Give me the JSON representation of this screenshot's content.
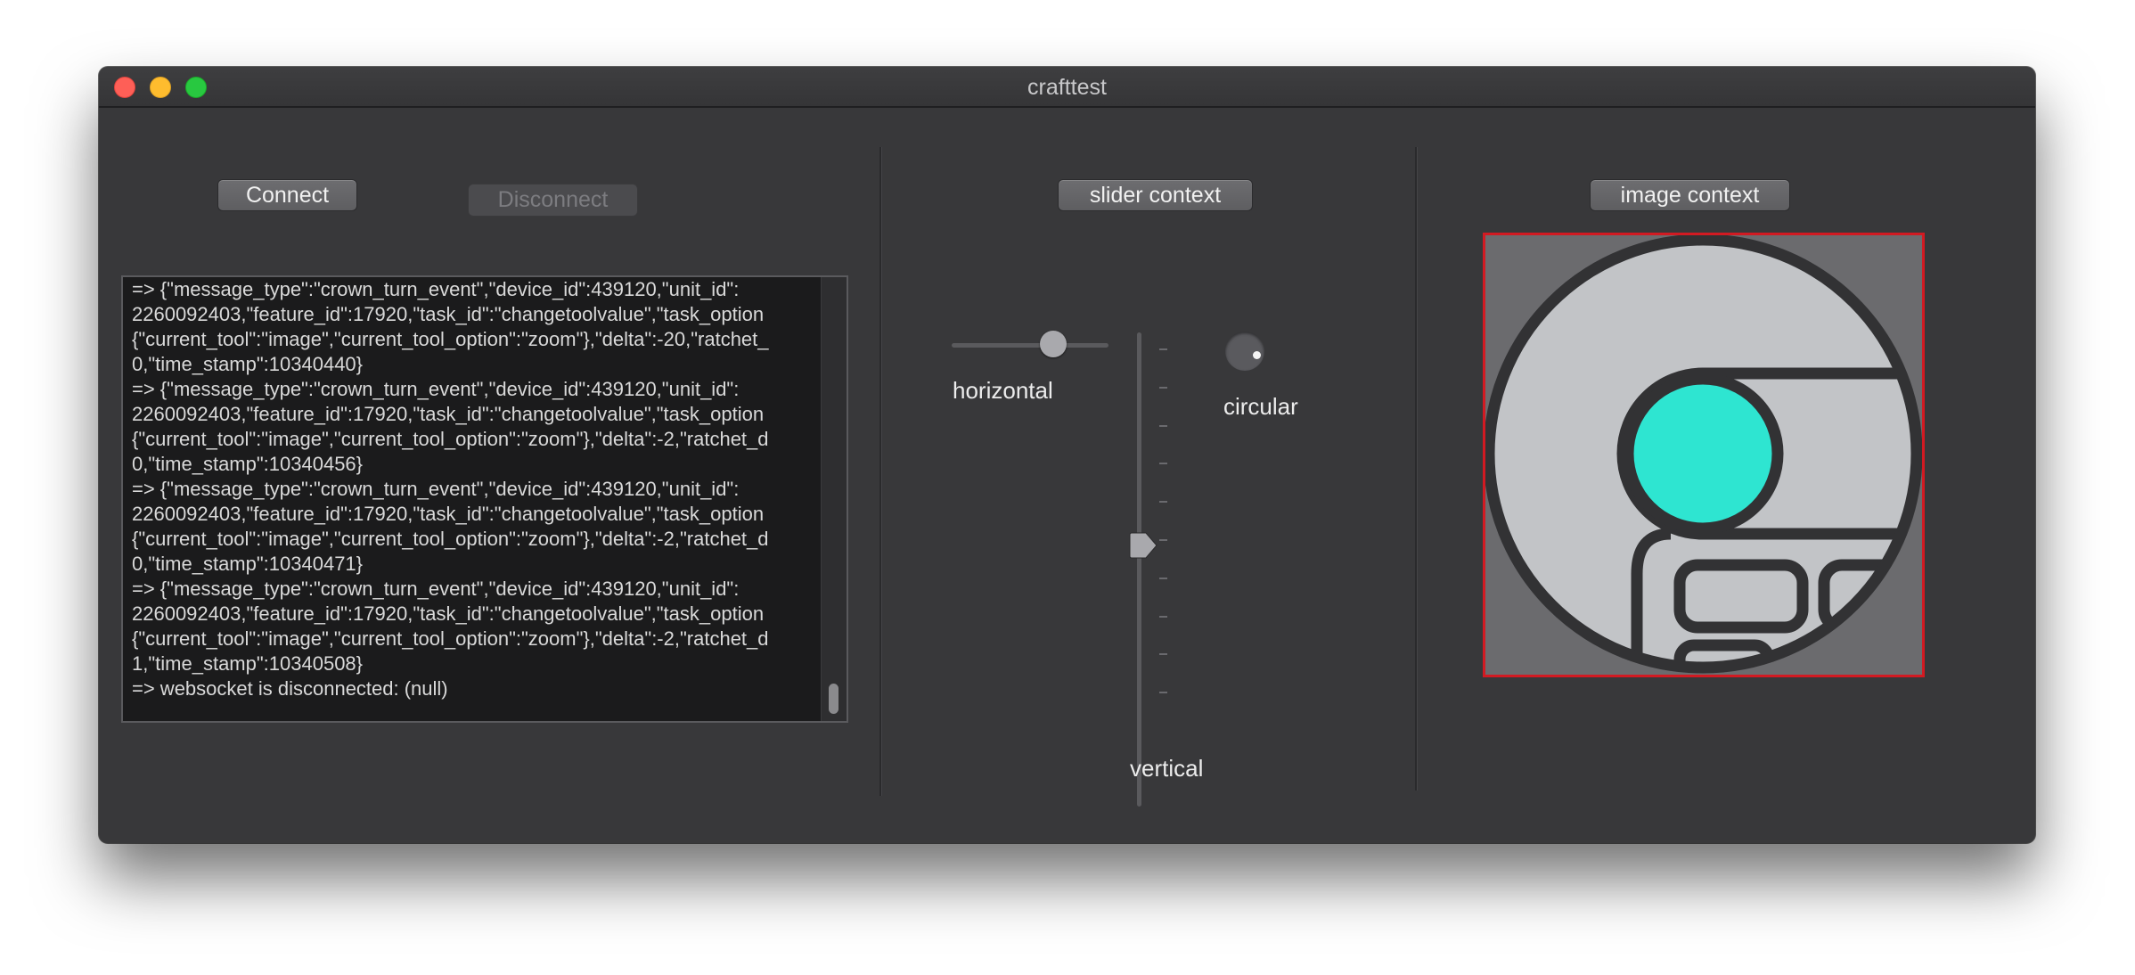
{
  "window": {
    "title": "crafttest"
  },
  "connection": {
    "connect_label": "Connect",
    "disconnect_label": "Disconnect"
  },
  "log": {
    "lines": [
      "=> {\"message_type\":\"crown_turn_event\",\"device_id\":439120,\"unit_id\":",
      "2260092403,\"feature_id\":17920,\"task_id\":\"changetoolvalue\",\"task_option",
      "{\"current_tool\":\"image\",\"current_tool_option\":\"zoom\"},\"delta\":-20,\"ratchet_",
      "0,\"time_stamp\":10340440}",
      "=> {\"message_type\":\"crown_turn_event\",\"device_id\":439120,\"unit_id\":",
      "2260092403,\"feature_id\":17920,\"task_id\":\"changetoolvalue\",\"task_option",
      "{\"current_tool\":\"image\",\"current_tool_option\":\"zoom\"},\"delta\":-2,\"ratchet_d",
      "0,\"time_stamp\":10340456}",
      "=> {\"message_type\":\"crown_turn_event\",\"device_id\":439120,\"unit_id\":",
      "2260092403,\"feature_id\":17920,\"task_id\":\"changetoolvalue\",\"task_option",
      "{\"current_tool\":\"image\",\"current_tool_option\":\"zoom\"},\"delta\":-2,\"ratchet_d",
      "0,\"time_stamp\":10340471}",
      "=> {\"message_type\":\"crown_turn_event\",\"device_id\":439120,\"unit_id\":",
      "2260092403,\"feature_id\":17920,\"task_id\":\"changetoolvalue\",\"task_option",
      "{\"current_tool\":\"image\",\"current_tool_option\":\"zoom\"},\"delta\":-2,\"ratchet_d",
      "1,\"time_stamp\":10340508}",
      "=> websocket is disconnected: (null)"
    ]
  },
  "sliders": {
    "context_label": "slider context",
    "horizontal": {
      "label": "horizontal",
      "value": 0.65
    },
    "vertical": {
      "label": "vertical",
      "value": 0.55
    },
    "circular": {
      "label": "circular",
      "angle_deg": 20
    }
  },
  "image": {
    "context_label": "image context",
    "frame_color": "#d21a22",
    "accent_color": "#2ee5d1"
  }
}
